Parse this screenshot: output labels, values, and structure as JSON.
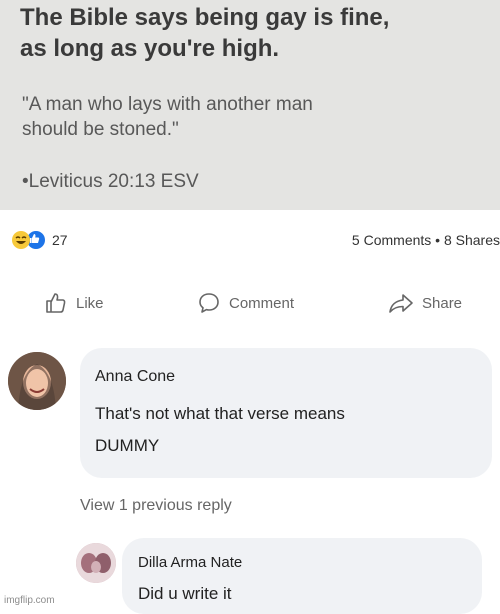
{
  "post": {
    "headline_line1": "The Bible says being gay is fine,",
    "headline_line2": "as long as you're high.",
    "quote_line1": "\"A man who lays with another man",
    "quote_line2": "should be stoned.\"",
    "citation": "•Leviticus 20:13 ESV"
  },
  "stats": {
    "reaction_count": "27",
    "comments_shares": "5 Comments • 8 Shares"
  },
  "actions": {
    "like": "Like",
    "comment": "Comment",
    "share": "Share"
  },
  "comment": {
    "author": "Anna Cone",
    "text_line1": "That's not what that verse means",
    "text_line2": "DUMMY"
  },
  "view_previous": "View 1 previous reply",
  "reply": {
    "author": "Dilla Arma Nate",
    "text": "Did u write it"
  },
  "watermark": "imgflip.com",
  "colors": {
    "post_background": "#e4e4e2",
    "bubble_background": "#f0f2f5",
    "like_blue": "#1d74e8",
    "haha_yellow": "#f7c93a"
  },
  "icons": {
    "reactions": [
      "haha-emoji-icon",
      "like-emoji-icon"
    ],
    "like": "thumbs-up-icon",
    "comment": "speech-bubble-icon",
    "share": "share-arrow-icon"
  }
}
